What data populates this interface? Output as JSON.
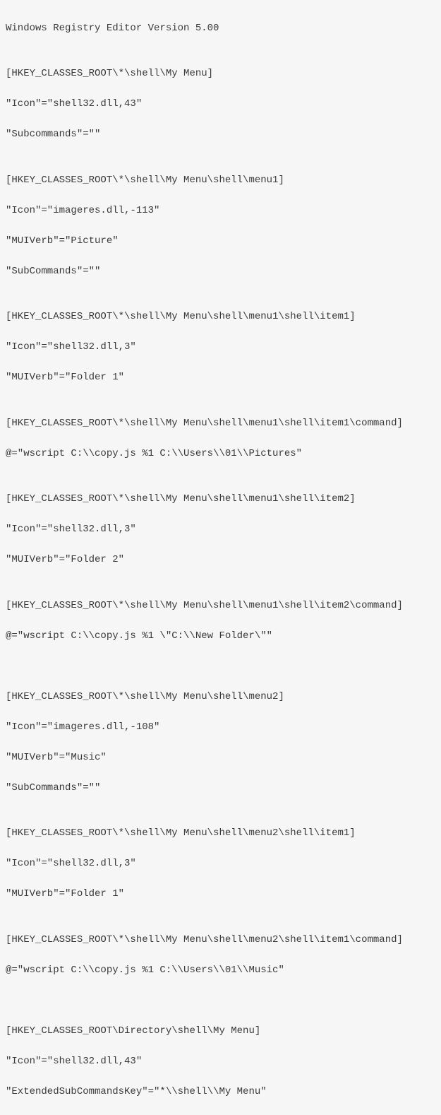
{
  "lines": [
    "Windows Registry Editor Version 5.00",
    "",
    "[HKEY_CLASSES_ROOT\\*\\shell\\My Menu]",
    "\"Icon\"=\"shell32.dll,43\"",
    "\"Subcommands\"=\"\"",
    "",
    "[HKEY_CLASSES_ROOT\\*\\shell\\My Menu\\shell\\menu1]",
    "\"Icon\"=\"imageres.dll,-113\"",
    "\"MUIVerb\"=\"Picture\"",
    "\"SubCommands\"=\"\"",
    "",
    "[HKEY_CLASSES_ROOT\\*\\shell\\My Menu\\shell\\menu1\\shell\\item1]",
    "\"Icon\"=\"shell32.dll,3\"",
    "\"MUIVerb\"=\"Folder 1\"",
    "",
    "[HKEY_CLASSES_ROOT\\*\\shell\\My Menu\\shell\\menu1\\shell\\item1\\command]",
    "@=\"wscript C:\\\\copy.js %1 C:\\\\Users\\\\01\\\\Pictures\"",
    "",
    "[HKEY_CLASSES_ROOT\\*\\shell\\My Menu\\shell\\menu1\\shell\\item2]",
    "\"Icon\"=\"shell32.dll,3\"",
    "\"MUIVerb\"=\"Folder 2\"",
    "",
    "[HKEY_CLASSES_ROOT\\*\\shell\\My Menu\\shell\\menu1\\shell\\item2\\command]",
    "@=\"wscript C:\\\\copy.js %1 \\\"C:\\\\New Folder\\\"\"",
    "",
    "",
    "[HKEY_CLASSES_ROOT\\*\\shell\\My Menu\\shell\\menu2]",
    "\"Icon\"=\"imageres.dll,-108\"",
    "\"MUIVerb\"=\"Music\"",
    "\"SubCommands\"=\"\"",
    "",
    "[HKEY_CLASSES_ROOT\\*\\shell\\My Menu\\shell\\menu2\\shell\\item1]",
    "\"Icon\"=\"shell32.dll,3\"",
    "\"MUIVerb\"=\"Folder 1\"",
    "",
    "[HKEY_CLASSES_ROOT\\*\\shell\\My Menu\\shell\\menu2\\shell\\item1\\command]",
    "@=\"wscript C:\\\\copy.js %1 C:\\\\Users\\\\01\\\\Music\"",
    "",
    "",
    "[HKEY_CLASSES_ROOT\\Directory\\shell\\My Menu]",
    "\"Icon\"=\"shell32.dll,43\"",
    "\"ExtendedSubCommandsKey\"=\"*\\\\shell\\\\My Menu\""
  ]
}
